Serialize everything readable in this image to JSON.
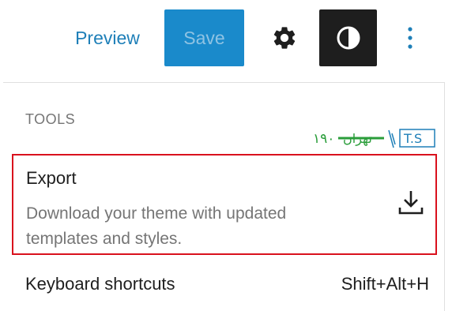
{
  "toolbar": {
    "preview_label": "Preview",
    "save_label": "Save",
    "settings_icon": "gear-icon",
    "style_icon": "contrast-icon",
    "more_icon": "more-vertical-icon"
  },
  "menu": {
    "section_title": "TOOLS",
    "items": [
      {
        "label": "Export",
        "description": "Download your theme with updated templates and styles.",
        "icon": "download-icon"
      },
      {
        "label": "Keyboard shortcuts",
        "shortcut": "Shift+Alt+H"
      }
    ]
  },
  "watermark": {
    "text": "T.S تهران ۱۹۰"
  },
  "colors": {
    "accent": "#1a8acb",
    "link": "#1e7fb8",
    "highlight_border": "#d9111d",
    "dark_button": "#1e1e1e",
    "muted_text": "#757575"
  }
}
